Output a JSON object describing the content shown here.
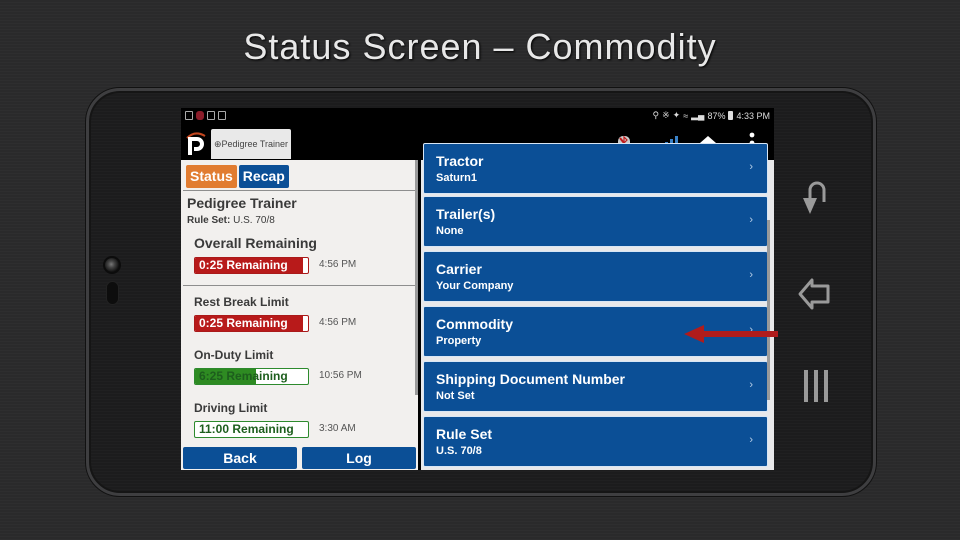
{
  "slide": {
    "title": "Status Screen – Commodity"
  },
  "device": {
    "hardware_buttons": [
      {
        "name": "recent-apps",
        "icon": "return-arrow-icon"
      },
      {
        "name": "back",
        "icon": "back-arrow-icon"
      },
      {
        "name": "menu",
        "icon": "menu-lines-icon"
      }
    ]
  },
  "statusbar": {
    "left_icons": [
      "notification-icon",
      "app-icon",
      "square-icon",
      "image-icon"
    ],
    "right_icons": [
      "location-icon",
      "bluetooth-icon",
      "mute-icon",
      "wifi-icon",
      "signal-icon"
    ],
    "battery": "87%",
    "time": "4:33 PM"
  },
  "appbar": {
    "logo": "pedigree-logo",
    "tab_label": "⊕Pedigree Trainer",
    "icons": [
      "bluetooth-disconnected-icon",
      "signal-bars-icon",
      "home-icon",
      "more-vertical-icon"
    ]
  },
  "left": {
    "tabs": [
      {
        "label": "Status",
        "active": true
      },
      {
        "label": "Recap",
        "active": false
      }
    ],
    "driver_name": "Pedigree Trainer",
    "rule_set_label": "Rule Set:",
    "rule_set_value": "U.S. 70/8",
    "limits": [
      {
        "title": "Overall Remaining",
        "remaining": "0:25 Remaining",
        "time": "4:56 PM",
        "status": "red",
        "fill_fraction": 0.96
      },
      {
        "title": "Rest Break Limit",
        "remaining": "0:25 Remaining",
        "time": "4:56 PM",
        "status": "red",
        "fill_fraction": 0.96
      },
      {
        "title": "On-Duty Limit",
        "remaining": "6:25 Remaining",
        "time": "10:56 PM",
        "status": "green",
        "fill_fraction": 0.54
      },
      {
        "title": "Driving Limit",
        "remaining": "11:00 Remaining",
        "time": "3:30 AM",
        "status": "green",
        "fill_fraction": 0.0
      }
    ],
    "buttons": {
      "back": "Back",
      "log": "Log"
    }
  },
  "right": {
    "cards": [
      {
        "title": "Tractor",
        "value": "Saturn1"
      },
      {
        "title": "Trailer(s)",
        "value": "None"
      },
      {
        "title": "Carrier",
        "value": "Your Company"
      },
      {
        "title": "Commodity",
        "value": "Property",
        "highlighted": true
      },
      {
        "title": "Shipping Document Number",
        "value": "Not Set"
      },
      {
        "title": "Rule Set",
        "value": "U.S. 70/8"
      }
    ],
    "chevron": "›"
  },
  "colors": {
    "primary_blue": "#0b4f96",
    "status_orange": "#e17c30",
    "alert_red": "#b81a1a",
    "ok_green": "#2e8b22",
    "annotation_arrow": "#b01c1c"
  }
}
